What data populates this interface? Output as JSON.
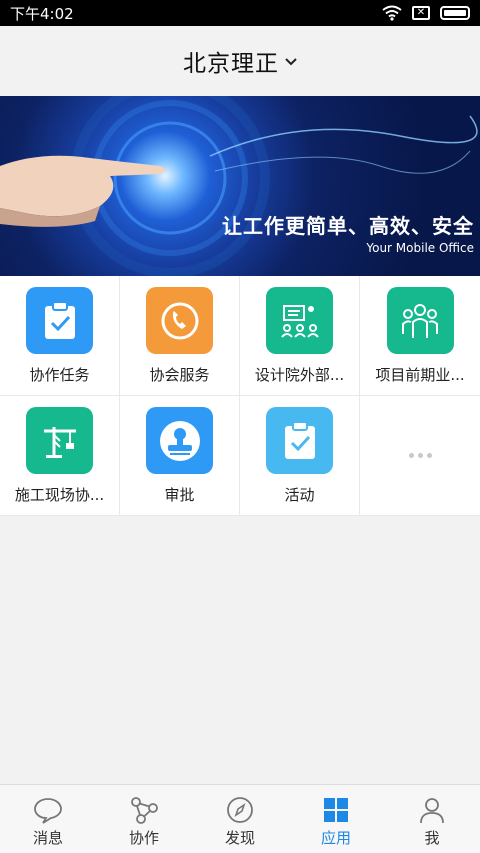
{
  "status_bar": {
    "time": "下午4:02",
    "sim_mark": "✕"
  },
  "header": {
    "title": "北京理正"
  },
  "banner": {
    "slogan": "让工作更简单、高效、安全",
    "subtitle": "Your Mobile Office"
  },
  "apps": [
    {
      "label": "协作任务",
      "icon": "clipboard-check-icon",
      "color": "#2f9af5"
    },
    {
      "label": "协会服务",
      "icon": "phone-icon",
      "color": "#f59a3b"
    },
    {
      "label": "设计院外部...",
      "icon": "presentation-icon",
      "color": "#16b88d"
    },
    {
      "label": "项目前期业...",
      "icon": "group-icon",
      "color": "#16b88d"
    },
    {
      "label": "施工现场协...",
      "icon": "crane-icon",
      "color": "#16b88d"
    },
    {
      "label": "审批",
      "icon": "stamp-icon",
      "color": "#2f9af5"
    },
    {
      "label": "活动",
      "icon": "clipboard-check-icon",
      "color": "#47b8f0"
    }
  ],
  "tabs": [
    {
      "label": "消息",
      "icon": "chat-icon",
      "active": false
    },
    {
      "label": "协作",
      "icon": "share-nodes-icon",
      "active": false
    },
    {
      "label": "发现",
      "icon": "compass-icon",
      "active": false
    },
    {
      "label": "应用",
      "icon": "grid-icon",
      "active": true
    },
    {
      "label": "我",
      "icon": "person-icon",
      "active": false
    }
  ],
  "colors": {
    "active_tab": "#1e88e5",
    "banner_dark": "#0d2263"
  }
}
